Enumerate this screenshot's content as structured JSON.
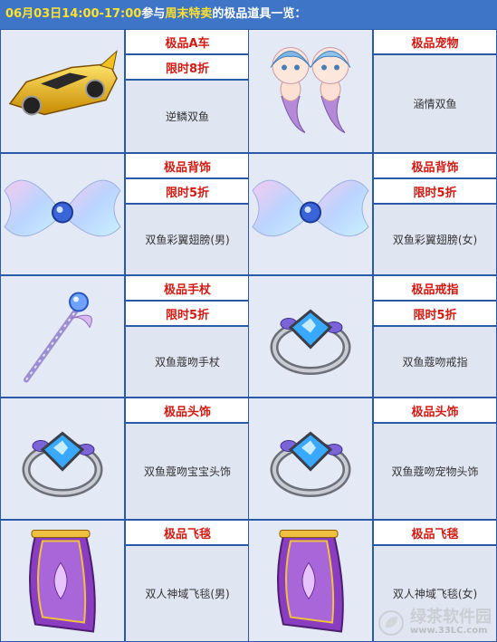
{
  "header": {
    "date_time": "06月03日14:00-17:00",
    "text1": "参与",
    "event_name": "周末特卖",
    "text2": "的极品道具一览："
  },
  "items": [
    {
      "category": "极品A车",
      "discount": "限时8折",
      "name": "逆鳞双鱼",
      "icon": "golden-race-car-icon"
    },
    {
      "category": "极品宠物",
      "discount": "",
      "name": "涵情双鱼",
      "icon": "twin-mermaid-pet-icon"
    },
    {
      "category": "极品背饰",
      "discount": "限时5折",
      "name": "双鱼彩翼翅膀(男)",
      "icon": "rainbow-wings-icon"
    },
    {
      "category": "极品背饰",
      "discount": "限时5折",
      "name": "双鱼彩翼翅膀(女)",
      "icon": "rainbow-wings-icon"
    },
    {
      "category": "极品手杖",
      "discount": "限时5折",
      "name": "双鱼蔻吻手杖",
      "icon": "crystal-scepter-icon"
    },
    {
      "category": "极品戒指",
      "discount": "限时5折",
      "name": "双鱼蔻吻戒指",
      "icon": "gem-ring-icon"
    },
    {
      "category": "极品头饰",
      "discount": "",
      "name": "双鱼蔻吻宝宝头饰",
      "icon": "gem-ring-icon"
    },
    {
      "category": "极品头饰",
      "discount": "",
      "name": "双鱼蔻吻宠物头饰",
      "icon": "gem-ring-icon"
    },
    {
      "category": "极品飞毯",
      "discount": "",
      "name": "双人神域飞毯(男)",
      "icon": "purple-flying-carpet-icon"
    },
    {
      "category": "极品飞毯",
      "discount": "",
      "name": "双人神域飞毯(女)",
      "icon": "purple-flying-carpet-icon"
    }
  ],
  "watermark": {
    "text": "绿茶软件园",
    "url": "www.33LC.com",
    "icon": "green-leaf-logo-icon"
  },
  "colors": {
    "header_bg": "#3f75c6",
    "highlight": "#ffe22b",
    "label_red": "#d11a12",
    "border_blue": "#2a5aa7",
    "image_bg": "#e4eaf5"
  }
}
